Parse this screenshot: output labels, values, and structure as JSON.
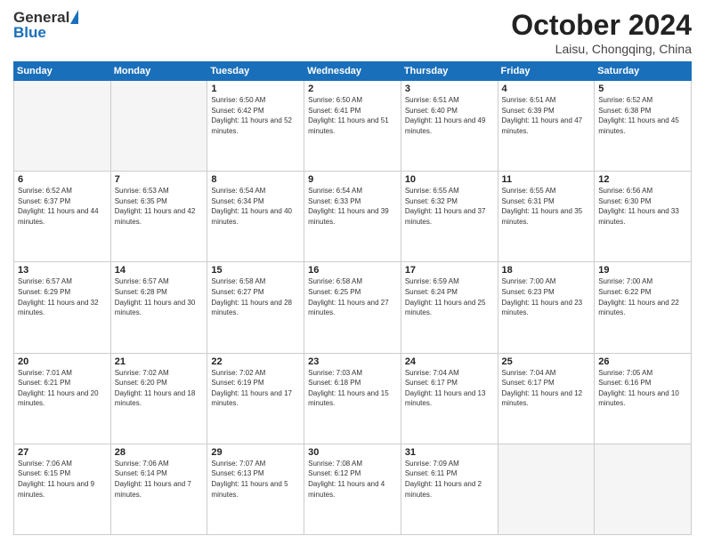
{
  "logo": {
    "general": "General",
    "blue": "Blue"
  },
  "header": {
    "month": "October 2024",
    "location": "Laisu, Chongqing, China"
  },
  "weekdays": [
    "Sunday",
    "Monday",
    "Tuesday",
    "Wednesday",
    "Thursday",
    "Friday",
    "Saturday"
  ],
  "weeks": [
    [
      {
        "day": "",
        "empty": true
      },
      {
        "day": "",
        "empty": true
      },
      {
        "day": "1",
        "sunrise": "6:50 AM",
        "sunset": "6:42 PM",
        "daylight": "11 hours and 52 minutes."
      },
      {
        "day": "2",
        "sunrise": "6:50 AM",
        "sunset": "6:41 PM",
        "daylight": "11 hours and 51 minutes."
      },
      {
        "day": "3",
        "sunrise": "6:51 AM",
        "sunset": "6:40 PM",
        "daylight": "11 hours and 49 minutes."
      },
      {
        "day": "4",
        "sunrise": "6:51 AM",
        "sunset": "6:39 PM",
        "daylight": "11 hours and 47 minutes."
      },
      {
        "day": "5",
        "sunrise": "6:52 AM",
        "sunset": "6:38 PM",
        "daylight": "11 hours and 45 minutes."
      }
    ],
    [
      {
        "day": "6",
        "sunrise": "6:52 AM",
        "sunset": "6:37 PM",
        "daylight": "11 hours and 44 minutes."
      },
      {
        "day": "7",
        "sunrise": "6:53 AM",
        "sunset": "6:35 PM",
        "daylight": "11 hours and 42 minutes."
      },
      {
        "day": "8",
        "sunrise": "6:54 AM",
        "sunset": "6:34 PM",
        "daylight": "11 hours and 40 minutes."
      },
      {
        "day": "9",
        "sunrise": "6:54 AM",
        "sunset": "6:33 PM",
        "daylight": "11 hours and 39 minutes."
      },
      {
        "day": "10",
        "sunrise": "6:55 AM",
        "sunset": "6:32 PM",
        "daylight": "11 hours and 37 minutes."
      },
      {
        "day": "11",
        "sunrise": "6:55 AM",
        "sunset": "6:31 PM",
        "daylight": "11 hours and 35 minutes."
      },
      {
        "day": "12",
        "sunrise": "6:56 AM",
        "sunset": "6:30 PM",
        "daylight": "11 hours and 33 minutes."
      }
    ],
    [
      {
        "day": "13",
        "sunrise": "6:57 AM",
        "sunset": "6:29 PM",
        "daylight": "11 hours and 32 minutes."
      },
      {
        "day": "14",
        "sunrise": "6:57 AM",
        "sunset": "6:28 PM",
        "daylight": "11 hours and 30 minutes."
      },
      {
        "day": "15",
        "sunrise": "6:58 AM",
        "sunset": "6:27 PM",
        "daylight": "11 hours and 28 minutes."
      },
      {
        "day": "16",
        "sunrise": "6:58 AM",
        "sunset": "6:25 PM",
        "daylight": "11 hours and 27 minutes."
      },
      {
        "day": "17",
        "sunrise": "6:59 AM",
        "sunset": "6:24 PM",
        "daylight": "11 hours and 25 minutes."
      },
      {
        "day": "18",
        "sunrise": "7:00 AM",
        "sunset": "6:23 PM",
        "daylight": "11 hours and 23 minutes."
      },
      {
        "day": "19",
        "sunrise": "7:00 AM",
        "sunset": "6:22 PM",
        "daylight": "11 hours and 22 minutes."
      }
    ],
    [
      {
        "day": "20",
        "sunrise": "7:01 AM",
        "sunset": "6:21 PM",
        "daylight": "11 hours and 20 minutes."
      },
      {
        "day": "21",
        "sunrise": "7:02 AM",
        "sunset": "6:20 PM",
        "daylight": "11 hours and 18 minutes."
      },
      {
        "day": "22",
        "sunrise": "7:02 AM",
        "sunset": "6:19 PM",
        "daylight": "11 hours and 17 minutes."
      },
      {
        "day": "23",
        "sunrise": "7:03 AM",
        "sunset": "6:18 PM",
        "daylight": "11 hours and 15 minutes."
      },
      {
        "day": "24",
        "sunrise": "7:04 AM",
        "sunset": "6:17 PM",
        "daylight": "11 hours and 13 minutes."
      },
      {
        "day": "25",
        "sunrise": "7:04 AM",
        "sunset": "6:17 PM",
        "daylight": "11 hours and 12 minutes."
      },
      {
        "day": "26",
        "sunrise": "7:05 AM",
        "sunset": "6:16 PM",
        "daylight": "11 hours and 10 minutes."
      }
    ],
    [
      {
        "day": "27",
        "sunrise": "7:06 AM",
        "sunset": "6:15 PM",
        "daylight": "11 hours and 9 minutes."
      },
      {
        "day": "28",
        "sunrise": "7:06 AM",
        "sunset": "6:14 PM",
        "daylight": "11 hours and 7 minutes."
      },
      {
        "day": "29",
        "sunrise": "7:07 AM",
        "sunset": "6:13 PM",
        "daylight": "11 hours and 5 minutes."
      },
      {
        "day": "30",
        "sunrise": "7:08 AM",
        "sunset": "6:12 PM",
        "daylight": "11 hours and 4 minutes."
      },
      {
        "day": "31",
        "sunrise": "7:09 AM",
        "sunset": "6:11 PM",
        "daylight": "11 hours and 2 minutes."
      },
      {
        "day": "",
        "empty": true
      },
      {
        "day": "",
        "empty": true
      }
    ]
  ]
}
